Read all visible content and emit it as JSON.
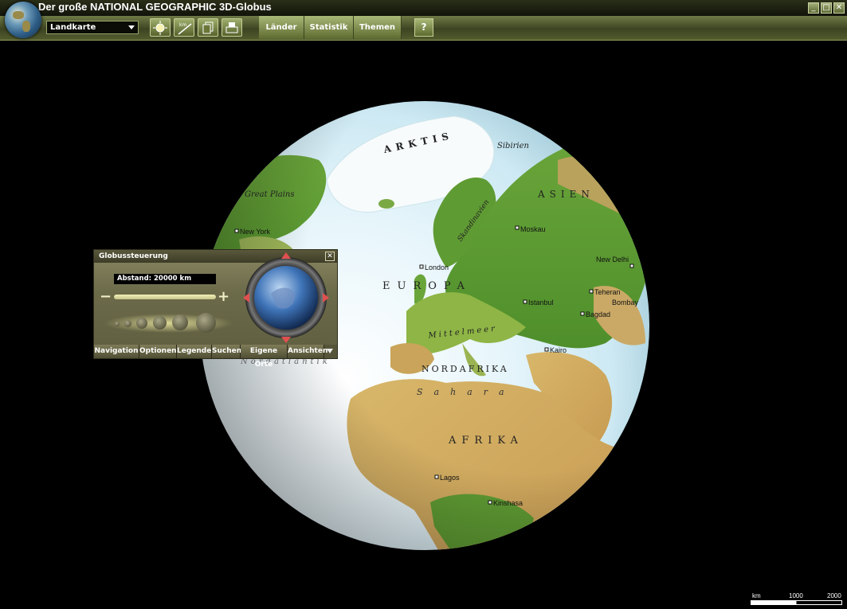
{
  "window": {
    "title": "Der große NATIONAL GEOGRAPHIC 3D-Globus",
    "controls": [
      "_",
      "□",
      "✕"
    ]
  },
  "toolbar": {
    "view_select": "Landkarte",
    "tabs": [
      "Länder",
      "Statistik",
      "Themen"
    ],
    "help_label": "?"
  },
  "map": {
    "labels": {
      "arktis": "ARKTIS",
      "sibirien": "Sibirien",
      "asien": "ASIEN",
      "great_plains": "Great Plains",
      "skandinavien": "Skandinavien",
      "europa": "EUROPA",
      "mittelmeer": "Mittelmeer",
      "nordafrika": "NORDAFRIKA",
      "sahara": "Sahara",
      "afrika": "AFRIKA",
      "nordatlantik": "Nordatlantik"
    },
    "cities": {
      "new_york": "New York",
      "moskau": "Moskau",
      "london": "London",
      "new_delhi": "New Delhi",
      "teheran": "Teheran",
      "bombay": "Bombay",
      "istanbul": "Istanbul",
      "bagdad": "Bagdad",
      "kairo": "Kairo",
      "lagos": "Lagos",
      "kinshasa": "Kinshasa"
    }
  },
  "panel": {
    "title": "Globussteuerung",
    "close_label": "✕",
    "distance": "Abstand:  20000 km",
    "zoom_minus": "−",
    "zoom_plus": "+",
    "tabs": [
      "Navigation",
      "Optionen",
      "Legende",
      "Suchen",
      "Eigene Orte",
      "Ansichten"
    ]
  },
  "scale": {
    "unit": "km",
    "ticks": [
      "1000",
      "2000"
    ]
  }
}
